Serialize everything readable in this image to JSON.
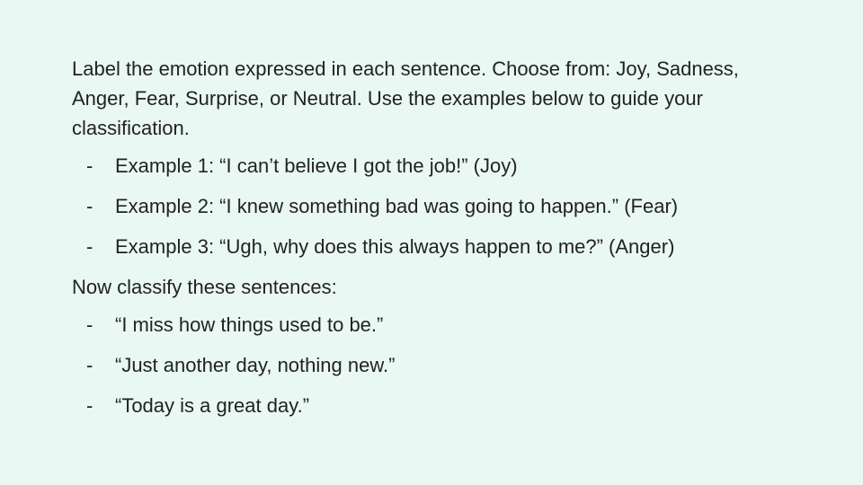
{
  "slide": {
    "instruction": "Label the emotion expressed in each sentence. Choose from: Joy, Sadness, Anger, Fear, Surprise, or Neutral. Use the examples below to guide your classification.",
    "bullet_marker": "-",
    "examples": [
      "Example 1: “I can’t believe I got the job!” (Joy)",
      "Example 2: “I knew something bad was going to happen.” (Fear)",
      "Example 3: “Ugh, why does this always happen to me?” (Anger)"
    ],
    "prompt": "Now classify these sentences:",
    "sentences": [
      "“I miss how things used to be.”",
      "“Just another day, nothing new.”",
      "“Today is a great day.”"
    ]
  }
}
